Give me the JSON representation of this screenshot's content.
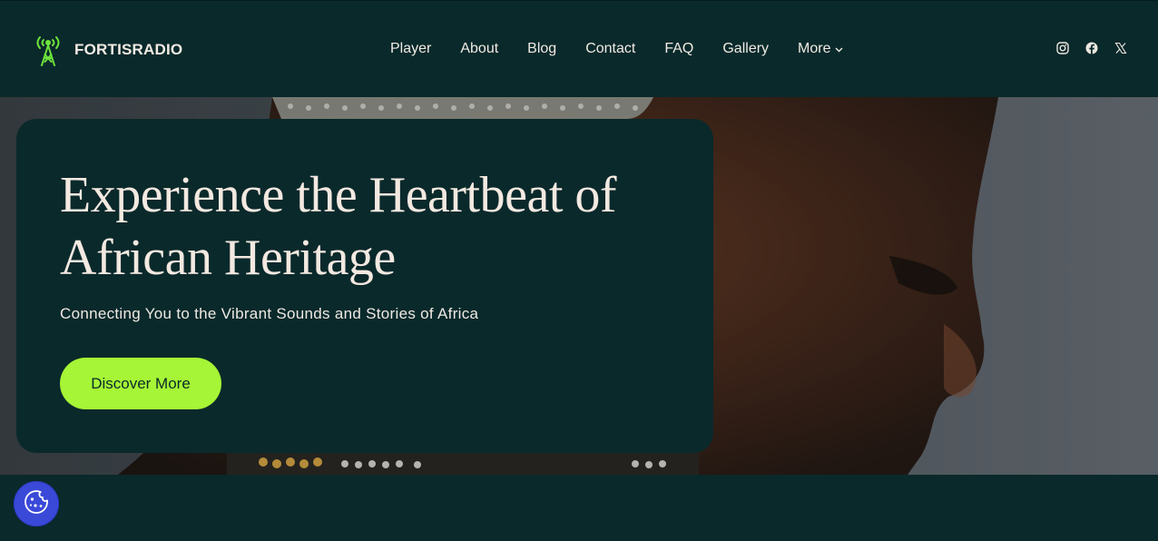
{
  "brand": {
    "name": "FORTISRADIO",
    "icon": "radio-tower-icon",
    "accent": "#a6f536"
  },
  "nav": {
    "items": [
      {
        "label": "Player"
      },
      {
        "label": "About"
      },
      {
        "label": "Blog"
      },
      {
        "label": "Contact"
      },
      {
        "label": "FAQ"
      },
      {
        "label": "Gallery"
      }
    ],
    "more_label": "More"
  },
  "social": [
    "instagram-icon",
    "facebook-icon",
    "x-icon"
  ],
  "hero": {
    "title": "Experience the Heartbeat of African Heritage",
    "subtitle": "Connecting You to the Vibrant Sounds and Stories of Africa",
    "cta_label": "Discover More"
  },
  "cookie": {
    "icon": "cookie-icon",
    "color": "#3a49d8"
  },
  "colors": {
    "background": "#0a292b",
    "text": "#f3e9e1",
    "button": "#a6f536"
  }
}
